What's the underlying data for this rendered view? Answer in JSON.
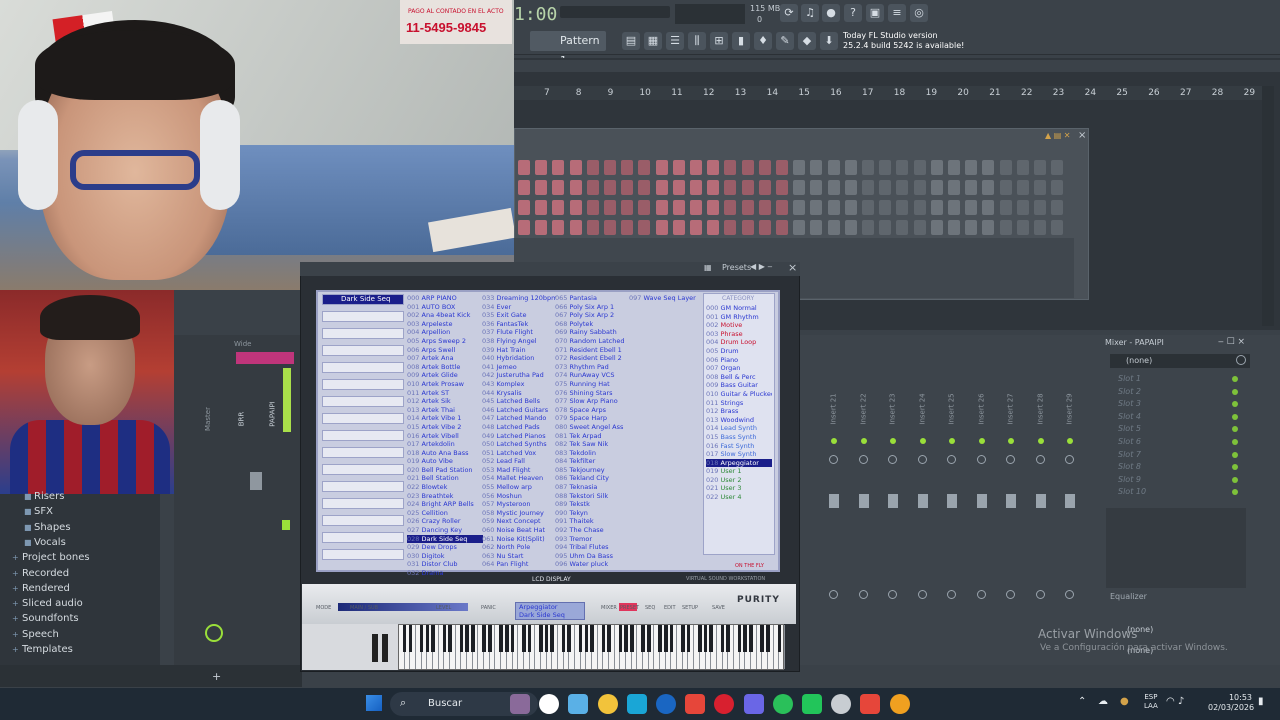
{
  "webcam": {
    "poster_small": "PAGO AL CONTADO EN EL ACTO",
    "poster_phone": "11-5495-9845"
  },
  "fl_toolbar": {
    "time": "1:00",
    "memory": "115 MB",
    "memory_zero": "0",
    "pattern": "Pattern 1",
    "update_line1": "Today  FL Studio version",
    "update_line2": "25.2.4 build 5242 is available!"
  },
  "playlist": {
    "ruler": [
      "7",
      "8",
      "9",
      "10",
      "11",
      "12",
      "13",
      "14",
      "15",
      "16",
      "17",
      "18",
      "19",
      "20",
      "21",
      "22",
      "23",
      "24",
      "25",
      "26",
      "27",
      "28",
      "29"
    ]
  },
  "purity": {
    "title": "Presets",
    "lcd_display": "LCD DISPLAY",
    "vsw": "VIRTUAL SOUND WORKSTATION",
    "logo": "PURITY",
    "panel_name_1": "Arpeggiator",
    "panel_name_2": "Dark Side Seq",
    "panel_buttons": [
      "MODE",
      "MAIN / SUB",
      "LEVEL",
      "PANIC",
      "MIXER",
      "PRESET",
      "SEQ",
      "EDIT",
      "SETUP",
      "SAVE"
    ],
    "on_the_fly": "ON THE FLY",
    "category_header": "CATEGORY",
    "layer_1": "Dark Side Seq",
    "col1": [
      {
        "n": "000",
        "t": "ARP PIANO"
      },
      {
        "n": "001",
        "t": "AUTO BOX"
      },
      {
        "n": "002",
        "t": "Ana 4beat Kick"
      },
      {
        "n": "003",
        "t": "Arpeleste"
      },
      {
        "n": "004",
        "t": "Arpellion"
      },
      {
        "n": "005",
        "t": "Arps Sweep 2"
      },
      {
        "n": "006",
        "t": "Arps Swell"
      },
      {
        "n": "007",
        "t": "Artek Ana"
      },
      {
        "n": "008",
        "t": "Artek Bottle"
      },
      {
        "n": "009",
        "t": "Artek Glide"
      },
      {
        "n": "010",
        "t": "Artek Prosaw"
      },
      {
        "n": "011",
        "t": "Artek ST"
      },
      {
        "n": "012",
        "t": "Artek Sik"
      },
      {
        "n": "013",
        "t": "Artek Thai"
      },
      {
        "n": "014",
        "t": "Artek Vibe 1"
      },
      {
        "n": "015",
        "t": "Artek Vibe 2"
      },
      {
        "n": "016",
        "t": "Artek Vibell"
      },
      {
        "n": "017",
        "t": "Artekdolin"
      },
      {
        "n": "018",
        "t": "Auto Ana Bass"
      },
      {
        "n": "019",
        "t": "Auto Vibe"
      },
      {
        "n": "020",
        "t": "Bell Pad Station"
      },
      {
        "n": "021",
        "t": "Bell Station"
      },
      {
        "n": "022",
        "t": "Blowtek"
      },
      {
        "n": "023",
        "t": "Breathtek"
      },
      {
        "n": "024",
        "t": "Bright ARP Bells"
      },
      {
        "n": "025",
        "t": "Cellition"
      },
      {
        "n": "026",
        "t": "Crazy Roller"
      },
      {
        "n": "027",
        "t": "Dancing Key"
      },
      {
        "n": "028",
        "t": "Dark Side Seq"
      },
      {
        "n": "029",
        "t": "Dew Drops"
      },
      {
        "n": "030",
        "t": "Digitok"
      },
      {
        "n": "031",
        "t": "Distor Club"
      },
      {
        "n": "032",
        "t": "Drama"
      }
    ],
    "col2": [
      {
        "n": "033",
        "t": "Dreaming 120bpm"
      },
      {
        "n": "034",
        "t": "Ever"
      },
      {
        "n": "035",
        "t": "Exit Gate"
      },
      {
        "n": "036",
        "t": "FantasTek"
      },
      {
        "n": "037",
        "t": "Flute Flight"
      },
      {
        "n": "038",
        "t": "Flying Angel"
      },
      {
        "n": "039",
        "t": "Hat Train"
      },
      {
        "n": "040",
        "t": "Hybridation"
      },
      {
        "n": "041",
        "t": "Jemeo"
      },
      {
        "n": "042",
        "t": "Justerutha Pad"
      },
      {
        "n": "043",
        "t": "Komplex"
      },
      {
        "n": "044",
        "t": "Krysalis"
      },
      {
        "n": "045",
        "t": "Latched Bells"
      },
      {
        "n": "046",
        "t": "Latched Guitars"
      },
      {
        "n": "047",
        "t": "Latched Mando"
      },
      {
        "n": "048",
        "t": "Latched Pads"
      },
      {
        "n": "049",
        "t": "Latched Pianos"
      },
      {
        "n": "050",
        "t": "Latched Synths"
      },
      {
        "n": "051",
        "t": "Latched Vox"
      },
      {
        "n": "052",
        "t": "Lead Fall"
      },
      {
        "n": "053",
        "t": "Mad Flight"
      },
      {
        "n": "054",
        "t": "Mallet Heaven"
      },
      {
        "n": "055",
        "t": "Mellow arp"
      },
      {
        "n": "056",
        "t": "Moshun"
      },
      {
        "n": "057",
        "t": "Mysteroon"
      },
      {
        "n": "058",
        "t": "Mystic Journey"
      },
      {
        "n": "059",
        "t": "Next Concept"
      },
      {
        "n": "060",
        "t": "Noise Beat Hat"
      },
      {
        "n": "061",
        "t": "Noise Kit(Split)"
      },
      {
        "n": "062",
        "t": "North Pole"
      },
      {
        "n": "063",
        "t": "Nu Start"
      },
      {
        "n": "064",
        "t": "Pan Flight"
      }
    ],
    "col3": [
      {
        "n": "065",
        "t": "Pantasia"
      },
      {
        "n": "066",
        "t": "Poly Six Arp 1"
      },
      {
        "n": "067",
        "t": "Poly Six Arp 2"
      },
      {
        "n": "068",
        "t": "Polytek"
      },
      {
        "n": "069",
        "t": "Rainy Sabbath"
      },
      {
        "n": "070",
        "t": "Random Latched"
      },
      {
        "n": "071",
        "t": "Resident Ebell 1"
      },
      {
        "n": "072",
        "t": "Resident Ebell 2"
      },
      {
        "n": "073",
        "t": "Rhythm Pad"
      },
      {
        "n": "074",
        "t": "RunAway VCS"
      },
      {
        "n": "075",
        "t": "Running Hat"
      },
      {
        "n": "076",
        "t": "Shining Stars"
      },
      {
        "n": "077",
        "t": "Slow Arp Piano"
      },
      {
        "n": "078",
        "t": "Space Arps"
      },
      {
        "n": "079",
        "t": "Space Harp"
      },
      {
        "n": "080",
        "t": "Sweet Angel Ass"
      },
      {
        "n": "081",
        "t": "Tek Arpad"
      },
      {
        "n": "082",
        "t": "Tek Saw Nik"
      },
      {
        "n": "083",
        "t": "Tekdolin"
      },
      {
        "n": "084",
        "t": "Tekfilter"
      },
      {
        "n": "085",
        "t": "Tekjourney"
      },
      {
        "n": "086",
        "t": "Tekland City"
      },
      {
        "n": "087",
        "t": "Teknasia"
      },
      {
        "n": "088",
        "t": "Tekstori Silk"
      },
      {
        "n": "089",
        "t": "Tekstk"
      },
      {
        "n": "090",
        "t": "Tekyn"
      },
      {
        "n": "091",
        "t": "Thaitek"
      },
      {
        "n": "092",
        "t": "The Chase"
      },
      {
        "n": "093",
        "t": "Tremor"
      },
      {
        "n": "094",
        "t": "Tribal Flutes"
      },
      {
        "n": "095",
        "t": "Uhm Da Bass"
      },
      {
        "n": "096",
        "t": "Water pluck"
      }
    ],
    "col4": [
      {
        "n": "097",
        "t": "Wave Seq Layer"
      }
    ],
    "categories": [
      {
        "n": "000",
        "t": "GM Normal"
      },
      {
        "n": "001",
        "t": "GM Rhythm"
      },
      {
        "n": "002",
        "t": "Motive"
      },
      {
        "n": "003",
        "t": "Phrase"
      },
      {
        "n": "004",
        "t": "Drum Loop"
      },
      {
        "n": "005",
        "t": "Drum"
      },
      {
        "n": "006",
        "t": "Piano"
      },
      {
        "n": "007",
        "t": "Organ"
      },
      {
        "n": "008",
        "t": "Bell & Perc"
      },
      {
        "n": "009",
        "t": "Bass Guitar"
      },
      {
        "n": "010",
        "t": "Guitar & Plucked"
      },
      {
        "n": "011",
        "t": "Strings"
      },
      {
        "n": "012",
        "t": "Brass"
      },
      {
        "n": "013",
        "t": "Woodwind"
      },
      {
        "n": "014",
        "t": "Lead Synth"
      },
      {
        "n": "015",
        "t": "Bass Synth"
      },
      {
        "n": "016",
        "t": "Fast Synth"
      },
      {
        "n": "017",
        "t": "Slow Synth"
      },
      {
        "n": "018",
        "t": "Arpeggiator"
      },
      {
        "n": "019",
        "t": "User 1"
      },
      {
        "n": "020",
        "t": "User 2"
      },
      {
        "n": "021",
        "t": "User 3"
      },
      {
        "n": "022",
        "t": "User 4"
      }
    ]
  },
  "mixer": {
    "title": "Mixer - PAPAIPI",
    "preset": "(none)",
    "slots": [
      "Slot 1",
      "Slot 2",
      "Slot 3",
      "Slot 4",
      "Slot 5",
      "Slot 6",
      "Slot 7",
      "Slot 8",
      "Slot 9",
      "Slot 10"
    ],
    "inserts": [
      "Insert 21",
      "Insert 22",
      "Insert 23",
      "Insert 24",
      "Insert 25",
      "Insert 26",
      "Insert 27",
      "Insert 28",
      "Insert 29"
    ],
    "eq_label": "Equalizer",
    "none_2": "(none)",
    "none_3": "(none)",
    "left_labels": [
      "Master",
      "BRR",
      "PAPAIPI"
    ],
    "left_top_label": "Wide"
  },
  "watermark": {
    "line1": "Activar Windows",
    "line2": "Ve a Configuración para activar Windows."
  },
  "browser": {
    "items": [
      "Risers",
      "SFX",
      "Shapes",
      "Vocals",
      "Project bones",
      "Recorded",
      "Rendered",
      "Sliced audio",
      "Soundfonts",
      "Speech",
      "Templates"
    ]
  },
  "taskbar": {
    "search": "Buscar",
    "lang_1": "ESP",
    "lang_2": "LAA",
    "time": "10:53",
    "date": "02/03/2026"
  }
}
